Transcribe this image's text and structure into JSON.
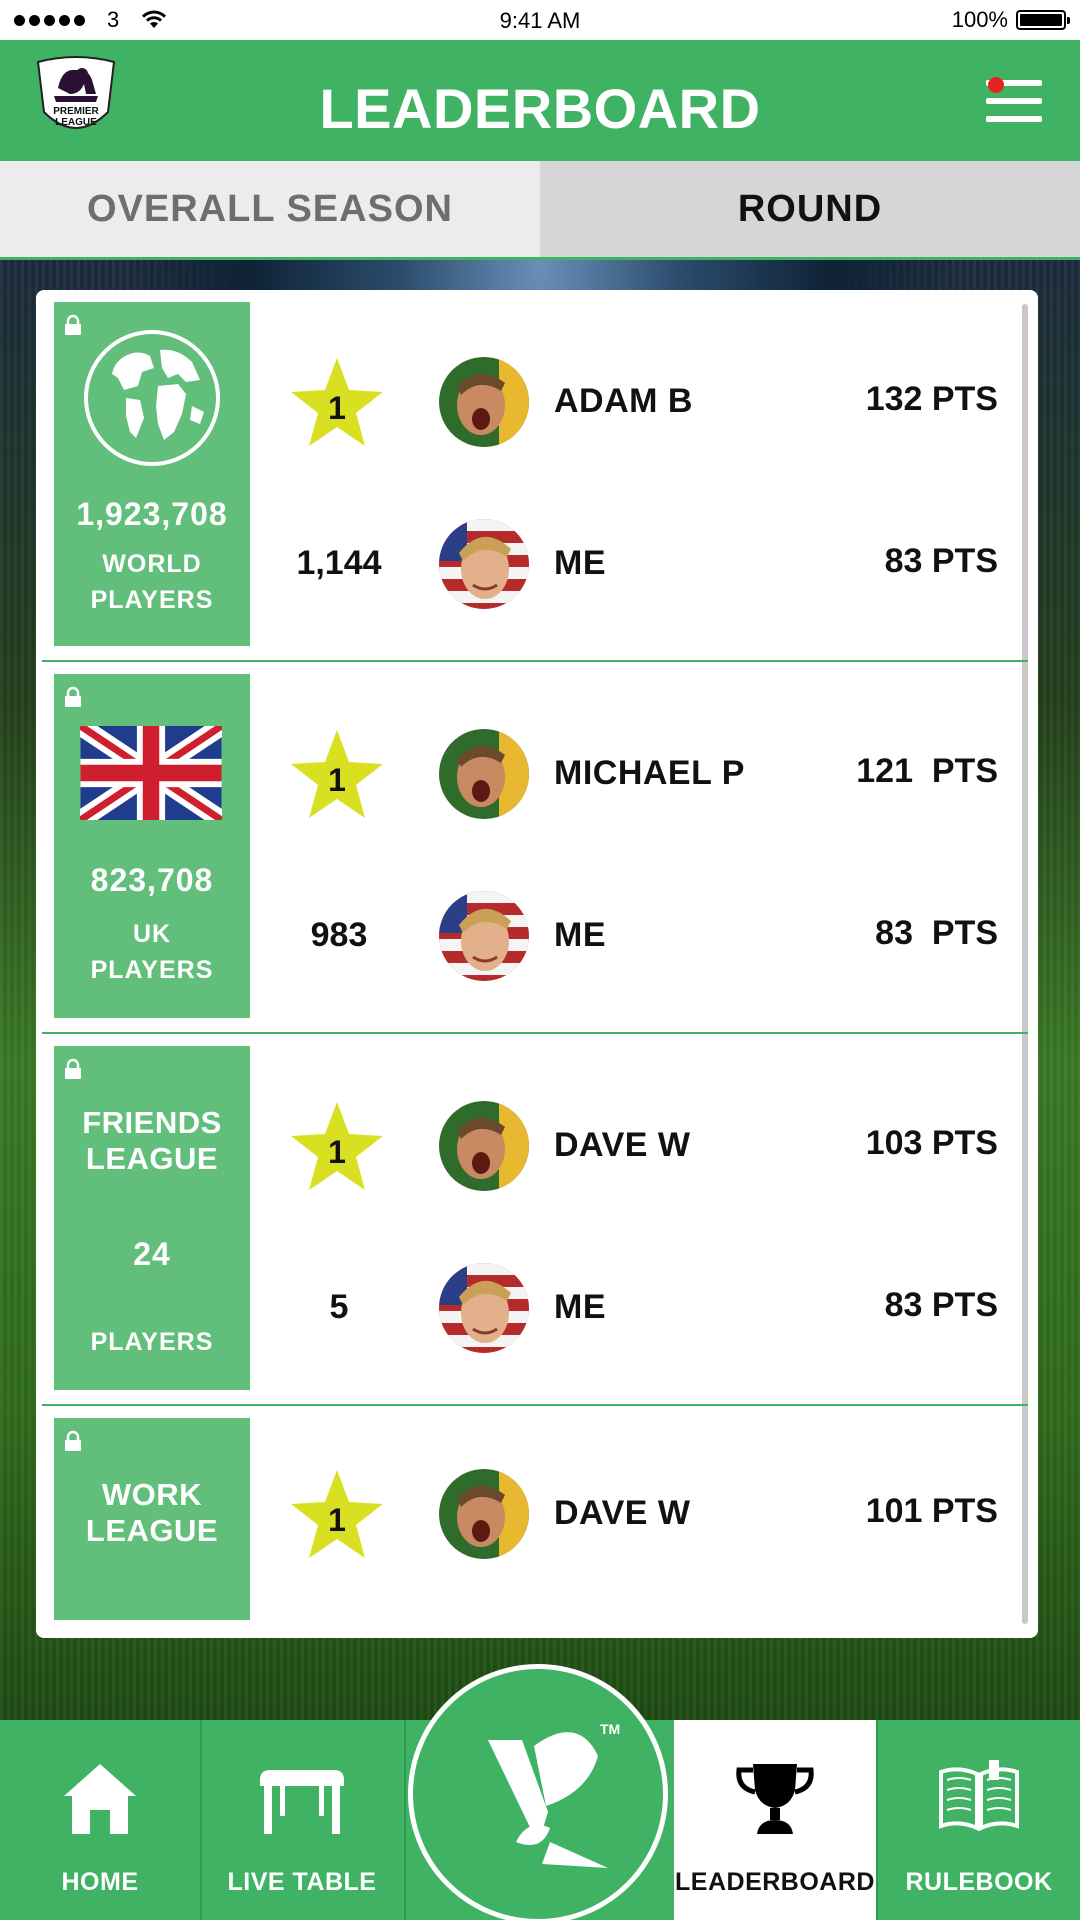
{
  "status_bar": {
    "carrier": "3",
    "time": "9:41 AM",
    "battery": "100%"
  },
  "header": {
    "title": "LEADERBOARD",
    "logo_text_1": "PREMIER",
    "logo_text_2": "LEAGUE",
    "notification_color": "#e52421"
  },
  "tabs": [
    {
      "label": "OVERALL SEASON",
      "active": false
    },
    {
      "label": "ROUND",
      "active": true
    }
  ],
  "colors": {
    "brand_green": "#3fb363",
    "panel_green": "#62bf7b",
    "star_yellow": "#d9e021"
  },
  "leagues": [
    {
      "icon": "globe-icon",
      "count": "1,923,708",
      "label_1": "WORLD",
      "label_2": "PLAYERS",
      "top": {
        "rank": "1",
        "name": "ADAM B",
        "points": "132 PTS"
      },
      "me": {
        "rank": "1,144",
        "name": "ME",
        "points": "83 PTS"
      }
    },
    {
      "icon": "uk-flag-icon",
      "count": "823,708",
      "label_1": "UK",
      "label_2": "PLAYERS",
      "top": {
        "rank": "1",
        "name": "MICHAEL P",
        "points": "121  PTS"
      },
      "me": {
        "rank": "983",
        "name": "ME",
        "points": "83  PTS"
      }
    },
    {
      "title_1": "FRIENDS",
      "title_2": "LEAGUE",
      "count": "24",
      "label_2": "PLAYERS",
      "top": {
        "rank": "1",
        "name": "DAVE W",
        "points": "103 PTS"
      },
      "me": {
        "rank": "5",
        "name": "ME",
        "points": "83 PTS"
      }
    },
    {
      "title_1": "WORK",
      "title_2": "LEAGUE",
      "top": {
        "rank": "1",
        "name": "DAVE W",
        "points": "101 PTS"
      }
    }
  ],
  "nav": {
    "home": "HOME",
    "live_table": "LIVE TABLE",
    "center_tm": "TM",
    "leaderboard": "LEADERBOARD",
    "rulebook": "RULEBOOK"
  }
}
